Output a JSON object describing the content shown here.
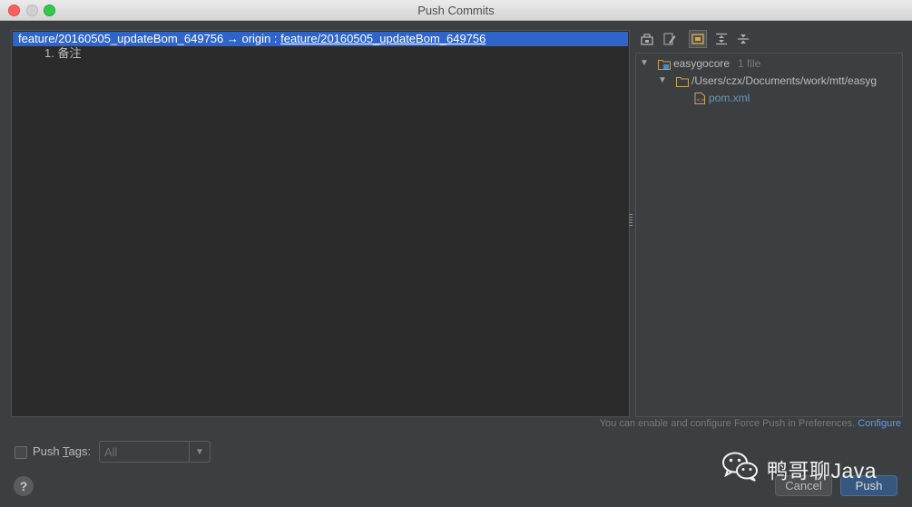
{
  "window": {
    "title": "Push Commits"
  },
  "commit": {
    "local_branch": "feature/20160505_updateBom_649756",
    "arrow": " → origin : ",
    "remote_branch": "feature/20160505_updateBom_649756",
    "notes": [
      "1. 备注"
    ]
  },
  "tree": {
    "root": {
      "label": "easygocore",
      "count": "1 file"
    },
    "path": "/Users/czx/Documents/work/mtt/easyg",
    "file": "pom.xml"
  },
  "hint": {
    "text": "You can enable and configure Force Push in Preferences. ",
    "link": "Configure"
  },
  "push_tags": {
    "label_prefix": "Push ",
    "label_mnemonic": "T",
    "label_suffix": "ags:",
    "value": "All"
  },
  "buttons": {
    "help": "?",
    "cancel": "Cancel",
    "push": "Push"
  },
  "watermark": {
    "text": "鸭哥聊Java"
  },
  "icons": [
    "traffic-light-close",
    "traffic-light-minimize",
    "traffic-light-zoom",
    "remote-icon",
    "edit-icon",
    "group-by-module-icon",
    "expand-all-icon",
    "collapse-all-icon",
    "module-icon",
    "folder-icon",
    "xml-file-icon",
    "wechat-icon"
  ]
}
